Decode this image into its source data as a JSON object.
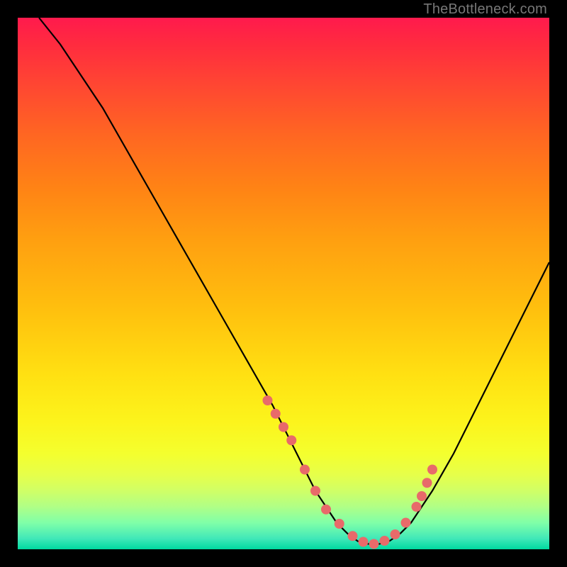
{
  "watermark": "TheBottleneck.com",
  "chart_data": {
    "type": "line",
    "title": "",
    "xlabel": "",
    "ylabel": "",
    "xlim": [
      0,
      100
    ],
    "ylim": [
      0,
      100
    ],
    "grid": false,
    "annotations": [],
    "series": [
      {
        "name": "curve",
        "x": [
          4,
          8,
          12,
          16,
          20,
          24,
          28,
          32,
          36,
          40,
          44,
          48,
          52,
          54,
          56,
          58,
          60,
          62,
          64,
          66,
          68,
          70,
          72,
          74,
          78,
          82,
          86,
          90,
          94,
          98,
          100
        ],
        "values": [
          100,
          95,
          89,
          83,
          76,
          69,
          62,
          55,
          48,
          41,
          34,
          27,
          19,
          15,
          11,
          8,
          5,
          3,
          1.5,
          1,
          1,
          1.6,
          3,
          5,
          11,
          18,
          26,
          34,
          42,
          50,
          54
        ]
      },
      {
        "name": "markers",
        "x": [
          47,
          48.5,
          50,
          51.5,
          54,
          56,
          58,
          60.5,
          63,
          65,
          67,
          69,
          71,
          73,
          75,
          76,
          77,
          78
        ],
        "values": [
          28,
          25.5,
          23,
          20.5,
          15,
          11,
          7.5,
          4.8,
          2.5,
          1.4,
          1,
          1.6,
          2.8,
          5,
          8,
          10,
          12.5,
          15
        ]
      }
    ],
    "colors": {
      "curve": "#000000",
      "markers": "#e86a6a"
    }
  }
}
